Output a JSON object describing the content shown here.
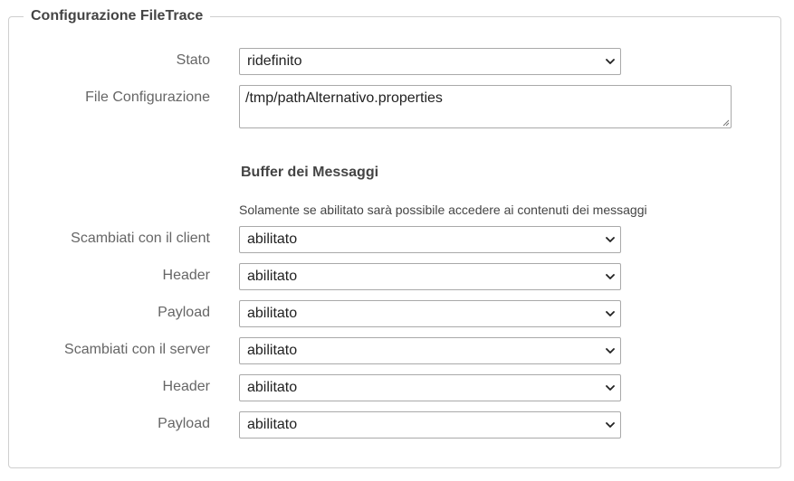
{
  "fieldset": {
    "legend": "Configurazione FileTrace"
  },
  "fields": {
    "stato": {
      "label": "Stato",
      "value": "ridefinito"
    },
    "file_configurazione": {
      "label": "File Configurazione",
      "value": "/tmp/pathAlternativo.properties"
    }
  },
  "buffer": {
    "title": "Buffer dei Messaggi",
    "note": "Solamente se abilitato sarà possibile accedere ai contenuti dei messaggi",
    "rows": [
      {
        "label": "Scambiati con il client",
        "value": "abilitato"
      },
      {
        "label": "Header",
        "value": "abilitato"
      },
      {
        "label": "Payload",
        "value": "abilitato"
      },
      {
        "label": "Scambiati con il server",
        "value": "abilitato"
      },
      {
        "label": "Header",
        "value": "abilitato"
      },
      {
        "label": "Payload",
        "value": "abilitato"
      }
    ]
  },
  "icons": {
    "dropdown": "chevron-down-icon",
    "resize": "resize-grip-icon"
  }
}
